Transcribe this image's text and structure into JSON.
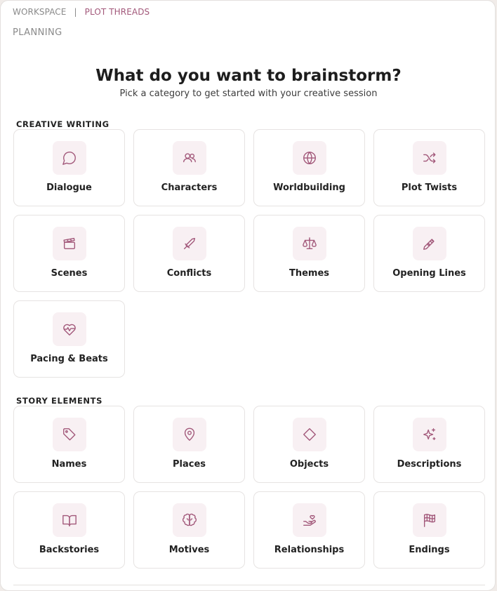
{
  "breadcrumb": {
    "root": "WORKSPACE",
    "separator": "|",
    "current": "PLOT THREADS"
  },
  "section_header": "PLANNING",
  "heading": {
    "title": "What do you want to brainstorm?",
    "subtitle": "Pick a category to get started with your creative session"
  },
  "creative_writing": {
    "label": "CREATIVE WRITING",
    "items": [
      {
        "label": "Dialogue",
        "icon": "chat-bubble-icon"
      },
      {
        "label": "Characters",
        "icon": "users-icon"
      },
      {
        "label": "Worldbuilding",
        "icon": "globe-icon"
      },
      {
        "label": "Plot Twists",
        "icon": "shuffle-icon"
      },
      {
        "label": "Scenes",
        "icon": "clapperboard-icon"
      },
      {
        "label": "Conflicts",
        "icon": "sword-icon"
      },
      {
        "label": "Themes",
        "icon": "scale-icon"
      },
      {
        "label": "Opening Lines",
        "icon": "pen-nib-icon"
      },
      {
        "label": "Pacing & Beats",
        "icon": "heart-pulse-icon"
      }
    ]
  },
  "story_elements": {
    "label": "STORY ELEMENTS",
    "items": [
      {
        "label": "Names",
        "icon": "tag-icon"
      },
      {
        "label": "Places",
        "icon": "map-pin-icon"
      },
      {
        "label": "Objects",
        "icon": "diamond-icon"
      },
      {
        "label": "Descriptions",
        "icon": "sparkles-icon"
      },
      {
        "label": "Backstories",
        "icon": "open-book-icon"
      },
      {
        "label": "Motives",
        "icon": "brain-icon"
      },
      {
        "label": "Relationships",
        "icon": "hand-heart-icon"
      },
      {
        "label": "Endings",
        "icon": "checkered-flag-icon"
      }
    ]
  },
  "colors": {
    "accent": "#a2587a",
    "icon_bg": "#f8f0f3",
    "card_border": "#e6e3e2"
  }
}
